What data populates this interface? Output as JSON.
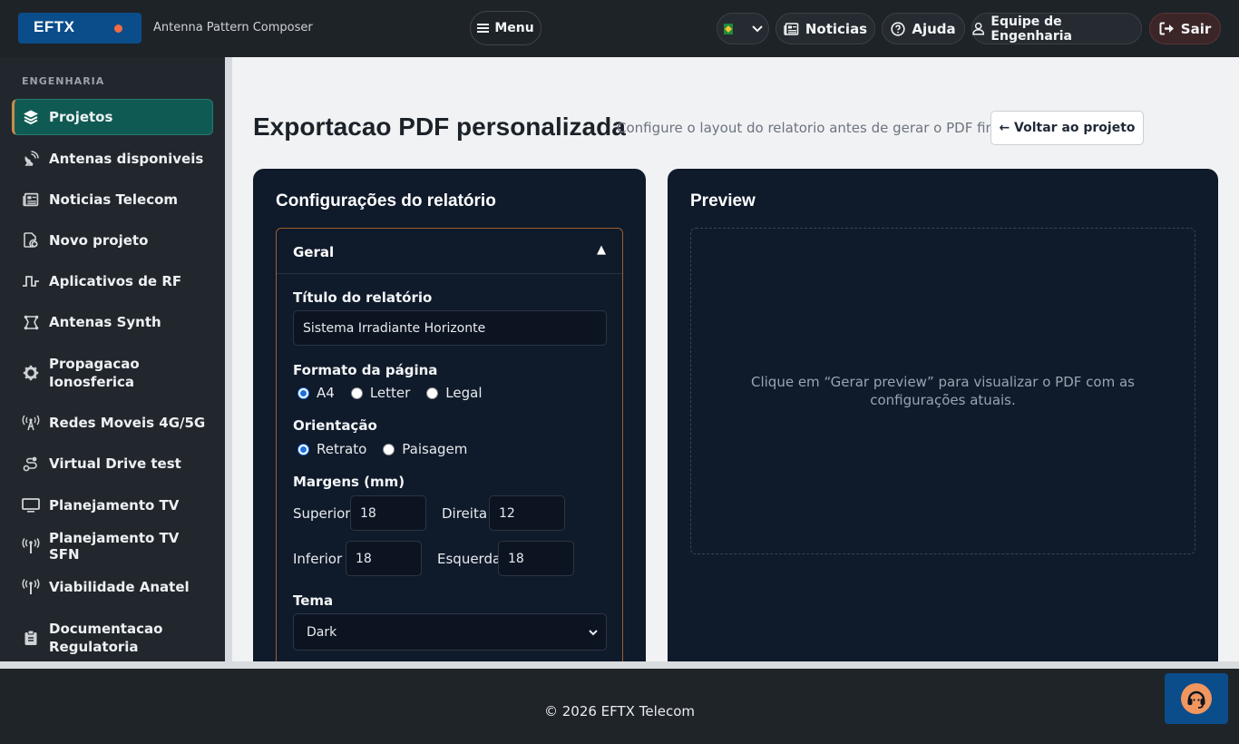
{
  "header": {
    "brand": "EFTX",
    "subtitle": "Antenna Pattern Composer",
    "menu_label": "Menu",
    "news_label": "Noticias",
    "help_label": "Ajuda",
    "team_label": "Equipe de Engenharia",
    "exit_label": "Sair"
  },
  "sidebar": {
    "section": "ENGENHARIA",
    "items": [
      {
        "label": "Projetos",
        "icon": "layers-icon"
      },
      {
        "label": "Antenas disponiveis",
        "icon": "satellite-dish-icon"
      },
      {
        "label": "Noticias Telecom",
        "icon": "newspaper-icon"
      },
      {
        "label": "Novo projeto",
        "icon": "file-plus-icon"
      },
      {
        "label": "Aplicativos de RF",
        "icon": "waveform-icon"
      },
      {
        "label": "Antenas Synth",
        "icon": "synth-shape-icon"
      },
      {
        "label": "Propagacao Ionosferica",
        "icon": "gear-icon"
      },
      {
        "label": "Redes Moveis 4G/5G",
        "icon": "tower-icon"
      },
      {
        "label": "Virtual Drive test",
        "icon": "route-icon"
      },
      {
        "label": "Planejamento TV",
        "icon": "monitor-icon"
      },
      {
        "label": "Planejamento TV SFN",
        "icon": "broadcast-icon"
      },
      {
        "label": "Viabilidade Anatel",
        "icon": "broadcast-icon"
      },
      {
        "label": "Documentacao Regulatoria",
        "icon": "clipboard-icon"
      }
    ]
  },
  "page": {
    "title": "Exportacao PDF personalizada",
    "hint": "Configure o layout do relatorio antes de gerar o PDF final.",
    "back_label": "← Voltar ao projeto"
  },
  "settings": {
    "title": "Configurações do relatório",
    "section": "Geral",
    "report_title_label": "Título do relatório",
    "report_title_value": "Sistema Irradiante Horizonte",
    "page_format_label": "Formato da página",
    "page_formats": [
      "A4",
      "Letter",
      "Legal"
    ],
    "page_format_selected": "A4",
    "orientation_label": "Orientação",
    "orientations": [
      "Retrato",
      "Paisagem"
    ],
    "orientation_selected": "Retrato",
    "margins_label": "Margens (mm)",
    "margins": {
      "top_label": "Superior",
      "top_value": "18",
      "right_label": "Direita",
      "right_value": "12",
      "bottom_label": "Inferior",
      "bottom_value": "18",
      "left_label": "Esquerda",
      "left_value": "18"
    },
    "theme_label": "Tema",
    "theme_value": "Dark"
  },
  "preview": {
    "title": "Preview",
    "placeholder": "Clique em “Gerar preview” para visualizar o PDF com as configurações atuais."
  },
  "footer": {
    "text": "© 2026 EFTX Telecom"
  },
  "colors": {
    "brand": "#0b4d8a",
    "accent": "#f26b43",
    "active_nav": "#0f5b54",
    "card": "#0f1a2b"
  }
}
